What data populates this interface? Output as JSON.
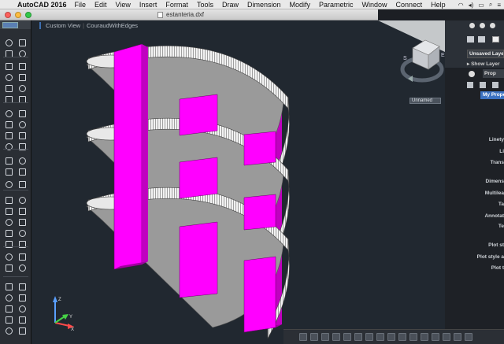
{
  "menubar": {
    "app_name": "AutoCAD 2016",
    "items": [
      "File",
      "Edit",
      "View",
      "Insert",
      "Format",
      "Tools",
      "Draw",
      "Dimension",
      "Modify",
      "Parametric",
      "Window",
      "Connect",
      "Help"
    ]
  },
  "window": {
    "title": "estanteria.dxf"
  },
  "viewport": {
    "view_label": "Custom View",
    "style_label": "CouraudWithEdges",
    "viewcube_label": "Unnamed"
  },
  "layers": {
    "current_layer": "Unsaved Layer",
    "show_layers": "Show Layer"
  },
  "properties": {
    "tab_label": "Prop",
    "selection_label": "My Propert",
    "labels": [
      "Linety",
      "Li",
      "Trans",
      "Dimens",
      "Multilea",
      "Ta",
      "Annotat",
      "Te",
      "Plot st",
      "Plot style a",
      "Plot t"
    ]
  },
  "colors": {
    "shelf_post": "#ff00ff",
    "shelf_top": "#e8e8e8",
    "shelf_underside": "#9a9a9a",
    "background": "#212830"
  }
}
